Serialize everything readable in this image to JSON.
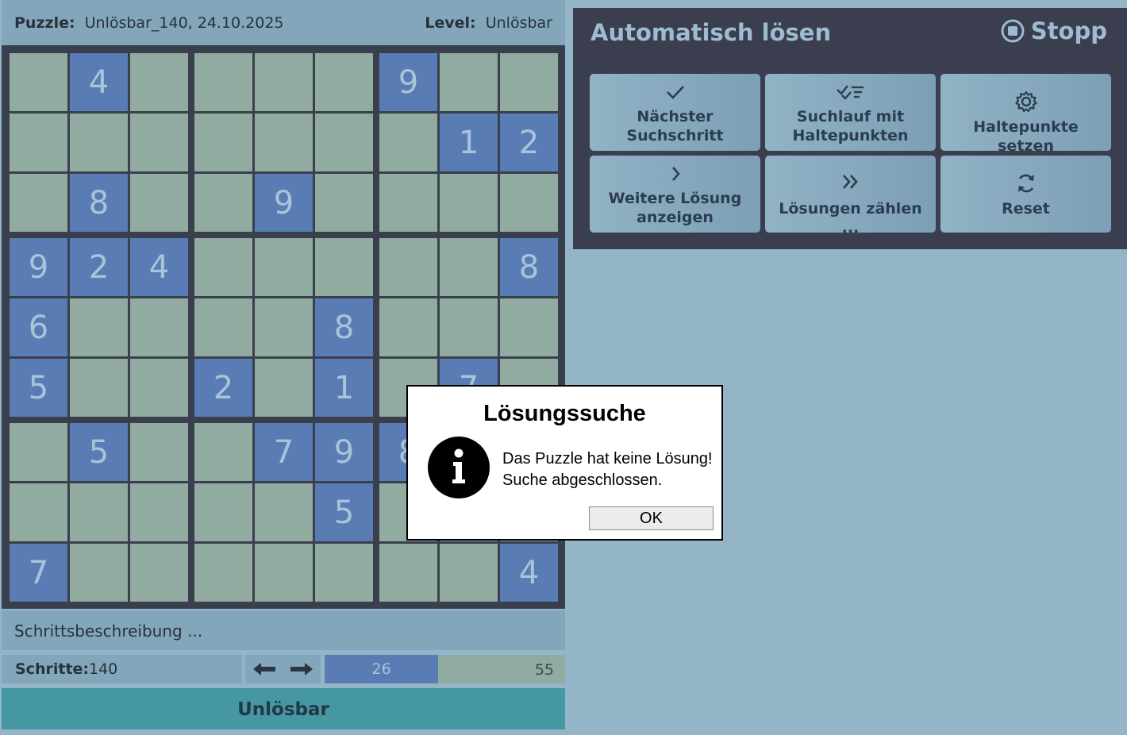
{
  "header": {
    "puzzle_label": "Puzzle:",
    "puzzle_value": "Unlösbar_140,  24.10.2025",
    "level_label": "Level:",
    "level_value": "Unlösbar"
  },
  "board": {
    "rows": [
      [
        "",
        "4",
        "",
        "",
        "",
        "",
        "9",
        "",
        ""
      ],
      [
        "",
        "",
        "",
        "",
        "",
        "",
        "",
        "1",
        "2"
      ],
      [
        "",
        "8",
        "",
        "",
        "9",
        "",
        "",
        "",
        ""
      ],
      [
        "9",
        "2",
        "4",
        "",
        "",
        "",
        "",
        "",
        "8"
      ],
      [
        "6",
        "",
        "",
        "",
        "",
        "8",
        "",
        "",
        ""
      ],
      [
        "5",
        "",
        "",
        "2",
        "",
        "1",
        "",
        "7",
        ""
      ],
      [
        "",
        "5",
        "",
        "",
        "7",
        "9",
        "8",
        "",
        ""
      ],
      [
        "",
        "",
        "",
        "",
        "",
        "5",
        "",
        "",
        ""
      ],
      [
        "7",
        "",
        "",
        "",
        "",
        "",
        "",
        "",
        "4"
      ]
    ]
  },
  "description": "Schrittsbeschreibung ...",
  "steps": {
    "label": "Schritte:",
    "value": "140"
  },
  "progress": {
    "current": "26",
    "max": "55"
  },
  "status": "Unlösbar",
  "solver": {
    "title": "Automatisch lösen",
    "stop_label": "Stopp",
    "buttons": [
      {
        "label": "Nächster\nSuchschritt",
        "icon": "check-icon"
      },
      {
        "label": "Suchlauf mit\nHaltepunkten",
        "icon": "check-list-icon"
      },
      {
        "label": "Haltepunkte setzen",
        "icon": "gear-icon"
      },
      {
        "label": "Weitere Lösung\nanzeigen",
        "icon": "chevron-right-icon"
      },
      {
        "label": "Lösungen zählen ...",
        "icon": "double-chevron-right-icon"
      },
      {
        "label": "Reset",
        "icon": "refresh-icon"
      }
    ]
  },
  "dialog": {
    "title": "Lösungssuche",
    "line1": "Das Puzzle hat keine Lösung!",
    "line2": "Suche abgeschlossen.",
    "ok_label": "OK"
  },
  "colors": {
    "background": "#94b4c7",
    "given_cell": "#5a7cb5",
    "empty_cell": "#91aba0",
    "board_border": "#3a3f4e",
    "status_bar": "#4597a2"
  }
}
